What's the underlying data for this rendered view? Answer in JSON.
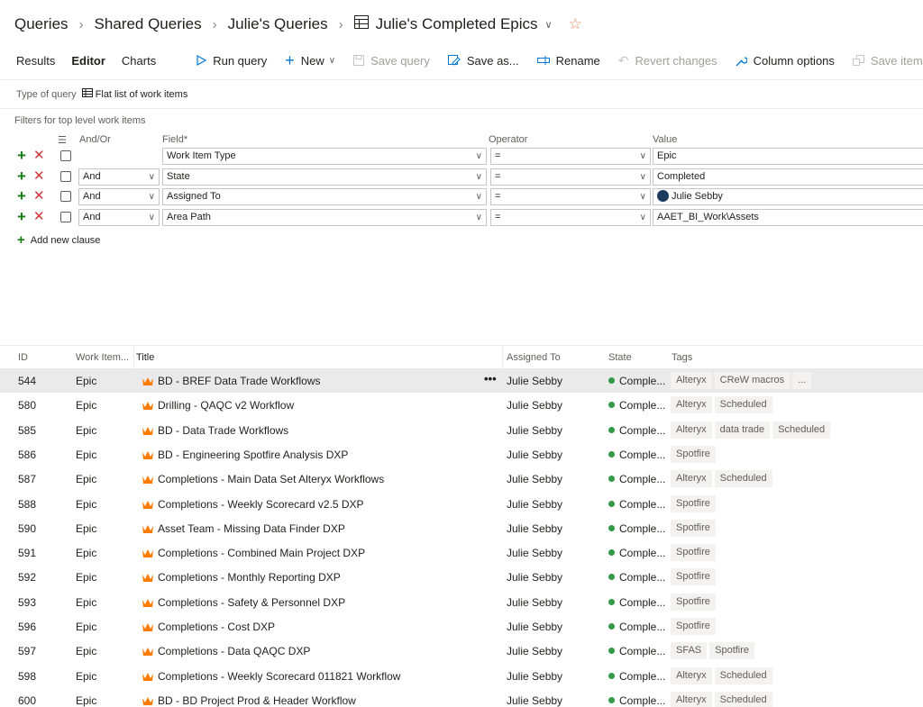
{
  "breadcrumb": {
    "items": [
      "Queries",
      "Shared Queries",
      "Julie's Queries"
    ],
    "current": "Julie's Completed Epics"
  },
  "toolbar": {
    "tabs": [
      "Results",
      "Editor",
      "Charts"
    ],
    "active_tab": "Editor",
    "commands": [
      {
        "label": "Run query",
        "icon": "play-icon",
        "disabled": false
      },
      {
        "label": "New",
        "icon": "plus-icon",
        "disabled": false
      },
      {
        "label": "Save query",
        "icon": "save-icon",
        "disabled": true
      },
      {
        "label": "Save as...",
        "icon": "save-as-icon",
        "disabled": false
      },
      {
        "label": "Rename",
        "icon": "rename-icon",
        "disabled": false
      },
      {
        "label": "Revert changes",
        "icon": "undo-icon",
        "disabled": true
      },
      {
        "label": "Column options",
        "icon": "wrench-icon",
        "disabled": false
      },
      {
        "label": "Save items",
        "icon": "save-items-icon",
        "disabled": true
      }
    ]
  },
  "query_type": {
    "label": "Type of query",
    "value": "Flat list of work items"
  },
  "filters": {
    "title": "Filters for top level work items",
    "headers": {
      "andor": "And/Or",
      "field": "Field*",
      "operator": "Operator",
      "value": "Value"
    },
    "clauses": [
      {
        "andor": "",
        "field": "Work Item Type",
        "operator": "=",
        "value": "Epic",
        "avatar": false
      },
      {
        "andor": "And",
        "field": "State",
        "operator": "=",
        "value": "Completed",
        "avatar": false
      },
      {
        "andor": "And",
        "field": "Assigned To",
        "operator": "=",
        "value": "Julie Sebby",
        "avatar": true
      },
      {
        "andor": "And",
        "field": "Area Path",
        "operator": "=",
        "value": "AAET_BI_Work\\Assets",
        "avatar": false
      }
    ],
    "add_clause": "Add new clause"
  },
  "grid": {
    "headers": {
      "id": "ID",
      "type": "Work Item...",
      "title": "Title",
      "assigned": "Assigned To",
      "state": "State",
      "tags": "Tags"
    },
    "rows": [
      {
        "id": "544",
        "type": "Epic",
        "title": "BD - BREF Data Trade Workflows",
        "assigned": "Julie Sebby",
        "state": "Comple...",
        "tags": [
          "Alteryx",
          "CReW macros",
          "..."
        ],
        "selected": true
      },
      {
        "id": "580",
        "type": "Epic",
        "title": "Drilling - QAQC v2 Workflow",
        "assigned": "Julie Sebby",
        "state": "Comple...",
        "tags": [
          "Alteryx",
          "Scheduled"
        ],
        "selected": false
      },
      {
        "id": "585",
        "type": "Epic",
        "title": "BD - Data Trade Workflows",
        "assigned": "Julie Sebby",
        "state": "Comple...",
        "tags": [
          "Alteryx",
          "data trade",
          "Scheduled"
        ],
        "selected": false
      },
      {
        "id": "586",
        "type": "Epic",
        "title": "BD - Engineering Spotfire Analysis DXP",
        "assigned": "Julie Sebby",
        "state": "Comple...",
        "tags": [
          "Spotfire"
        ],
        "selected": false
      },
      {
        "id": "587",
        "type": "Epic",
        "title": "Completions - Main Data Set Alteryx Workflows",
        "assigned": "Julie Sebby",
        "state": "Comple...",
        "tags": [
          "Alteryx",
          "Scheduled"
        ],
        "selected": false
      },
      {
        "id": "588",
        "type": "Epic",
        "title": "Completions - Weekly Scorecard v2.5 DXP",
        "assigned": "Julie Sebby",
        "state": "Comple...",
        "tags": [
          "Spotfire"
        ],
        "selected": false
      },
      {
        "id": "590",
        "type": "Epic",
        "title": "Asset Team - Missing Data Finder DXP",
        "assigned": "Julie Sebby",
        "state": "Comple...",
        "tags": [
          "Spotfire"
        ],
        "selected": false
      },
      {
        "id": "591",
        "type": "Epic",
        "title": "Completions - Combined Main Project DXP",
        "assigned": "Julie Sebby",
        "state": "Comple...",
        "tags": [
          "Spotfire"
        ],
        "selected": false
      },
      {
        "id": "592",
        "type": "Epic",
        "title": "Completions - Monthly Reporting DXP",
        "assigned": "Julie Sebby",
        "state": "Comple...",
        "tags": [
          "Spotfire"
        ],
        "selected": false
      },
      {
        "id": "593",
        "type": "Epic",
        "title": "Completions - Safety & Personnel DXP",
        "assigned": "Julie Sebby",
        "state": "Comple...",
        "tags": [
          "Spotfire"
        ],
        "selected": false
      },
      {
        "id": "596",
        "type": "Epic",
        "title": "Completions - Cost DXP",
        "assigned": "Julie Sebby",
        "state": "Comple...",
        "tags": [
          "Spotfire"
        ],
        "selected": false
      },
      {
        "id": "597",
        "type": "Epic",
        "title": "Completions - Data QAQC DXP",
        "assigned": "Julie Sebby",
        "state": "Comple...",
        "tags": [
          "SFAS",
          "Spotfire"
        ],
        "selected": false
      },
      {
        "id": "598",
        "type": "Epic",
        "title": "Completions - Weekly Scorecard 011821 Workflow",
        "assigned": "Julie Sebby",
        "state": "Comple...",
        "tags": [
          "Alteryx",
          "Scheduled"
        ],
        "selected": false
      },
      {
        "id": "600",
        "type": "Epic",
        "title": "BD - BD Project Prod & Header Workflow",
        "assigned": "Julie Sebby",
        "state": "Comple...",
        "tags": [
          "Alteryx",
          "Scheduled"
        ],
        "selected": false
      }
    ]
  },
  "colors": {
    "accent": "#0078d4",
    "add_green": "#107c10",
    "remove_red": "#d13438",
    "completed_green": "#339947",
    "epic_orange": "#ff7b00",
    "star": "#e8875b"
  }
}
